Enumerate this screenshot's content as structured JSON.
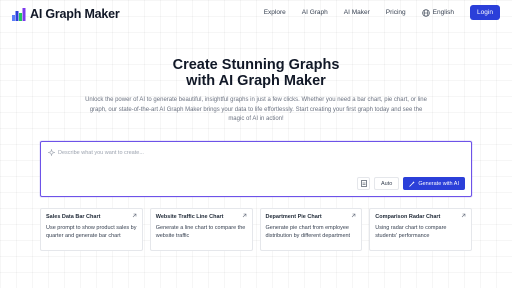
{
  "header": {
    "logo_text": "AI Graph Maker",
    "nav": [
      {
        "label": "Explore"
      },
      {
        "label": "AI Graph"
      },
      {
        "label": "AI Maker"
      },
      {
        "label": "Pricing"
      }
    ],
    "language": "English",
    "login_label": "Login"
  },
  "hero": {
    "title_line1": "Create Stunning Graphs",
    "title_line2": "with AI Graph Maker",
    "subtitle": "Unlock the power of AI to generate beautiful, insightful graphs in just a few clicks. Whether you need a bar chart, pie chart, or line graph, our state-of-the-art AI Graph Maker brings your data to life effortlessly. Start creating your first graph today and see the magic of AI in action!"
  },
  "prompt": {
    "placeholder": "Describe what you want to create...",
    "auto_label": "Auto",
    "generate_label": "Generate with AI"
  },
  "cards": [
    {
      "title": "Sales Data Bar Chart",
      "desc": "Use prompt to show product sales by quarter and generate bar chart"
    },
    {
      "title": "Website Traffic Line Chart",
      "desc": "Generate a line chart to compare the website traffic"
    },
    {
      "title": "Department Pie Chart",
      "desc": "Generate pie chart from employee distribution by different department"
    },
    {
      "title": "Comparison Radar Chart",
      "desc": "Using radar chart to compare students' performance"
    }
  ],
  "colors": {
    "accent": "#2b3fd9",
    "prompt_border": "#6d52e8"
  },
  "icons": [
    "bar-chart-logo-icon",
    "globe-icon",
    "sparkle-icon",
    "document-icon",
    "magic-wand-icon",
    "arrow-up-right-icon"
  ]
}
